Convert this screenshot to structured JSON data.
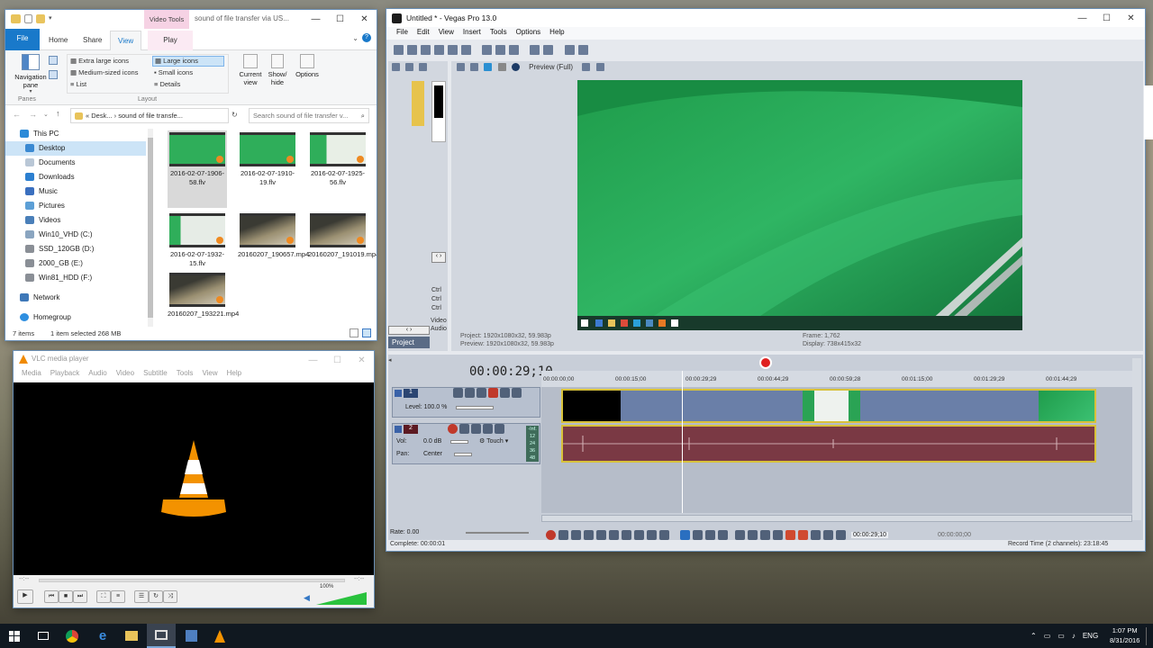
{
  "explorer": {
    "title": "sound of file transfer via US...",
    "context_tab": "Video Tools",
    "tabs": [
      "File",
      "Home",
      "Share",
      "View",
      "Play"
    ],
    "ribbon": {
      "nav_pane": "Navigation pane",
      "layout_options": [
        "Extra large icons",
        "Large icons",
        "Medium-sized icons",
        "Small icons",
        "List",
        "Details"
      ],
      "current_view": "Current view",
      "show_hide": "Show/ hide",
      "options": "Options",
      "group_panes": "Panes",
      "group_layout": "Layout"
    },
    "address": "«  Desk...  ›  sound of file transfe...",
    "search_placeholder": "Search sound of file transfer v...",
    "nav": [
      "This PC",
      "Desktop",
      "Documents",
      "Downloads",
      "Music",
      "Pictures",
      "Videos",
      "Win10_VHD (C:)",
      "SSD_120GB (D:)",
      "2000_GB (E:)",
      "Win81_HDD (F:)",
      "Network",
      "Homegroup"
    ],
    "files": [
      {
        "name": "2016-02-07-1906-58.flv"
      },
      {
        "name": "2016-02-07-1910-19.flv"
      },
      {
        "name": "2016-02-07-1925-56.flv"
      },
      {
        "name": "2016-02-07-1932-15.flv"
      },
      {
        "name": "20160207_190657.mp4"
      },
      {
        "name": "20160207_191019.mp4"
      },
      {
        "name": "20160207_193221.mp4"
      }
    ],
    "status_items": "7 items",
    "status_selected": "1 item selected  268 MB"
  },
  "vegas": {
    "title": "Untitled * - Vegas Pro 13.0",
    "menu": [
      "File",
      "Edit",
      "View",
      "Insert",
      "Tools",
      "Options",
      "Help"
    ],
    "preview_mode": "Preview (Full)",
    "project_tab": "Project",
    "video_tab": "Video",
    "audio_tab": "Audio",
    "ctrl_labels": [
      "Ctrl",
      "Ctrl",
      "Ctrl"
    ],
    "project_info": "Project:  1920x1080x32, 59.983p",
    "preview_info": "Preview:  1920x1080x32, 59.983p",
    "frame_info": "Frame:     1,762",
    "display_info": "Display:  738x415x32",
    "timecode": "00:00:29;10",
    "ruler": [
      "00:00:00;00",
      "00:00:15;00",
      "00:00:29;29",
      "00:00:44;29",
      "00:00:59;28",
      "00:01:15;00",
      "00:01:29;29",
      "00:01:44;29"
    ],
    "video_track": {
      "num": "1",
      "level": "Level: 100.0 %"
    },
    "audio_track": {
      "num": "2",
      "vol": "Vol:",
      "vol_val": "0.0 dB",
      "touch": "Touch",
      "pan": "Pan:",
      "pan_val": "Center",
      "meter": [
        "-Inf.",
        "12",
        "24",
        "36",
        "48"
      ]
    },
    "rate": "Rate: 0.00",
    "transport_time": "00:00:29;10",
    "transport_time2": "00:00:00;00",
    "complete": "Complete: 00:00:01",
    "record_time": "Record Time (2 channels): 23:18:45"
  },
  "vlc": {
    "title": "VLC media player",
    "menu": [
      "Media",
      "Playback",
      "Audio",
      "Video",
      "Subtitle",
      "Tools",
      "View",
      "Help"
    ],
    "time_left": "--:--",
    "time_right": "--:--",
    "volume": "100%"
  },
  "taskbar": {
    "lang": "ENG",
    "time": "1:07 PM",
    "date": "8/31/2016"
  },
  "colors": {
    "accent": "#2b79d0",
    "vegas_video": "#6a7fa8",
    "vegas_audio": "#7a3944",
    "clip_border": "#d8c23a"
  }
}
